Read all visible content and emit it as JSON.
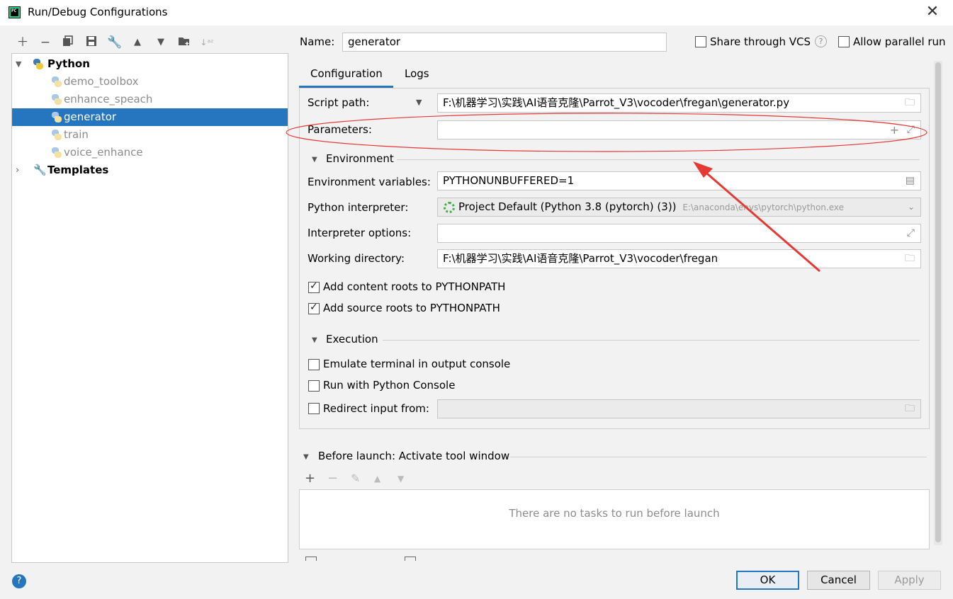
{
  "window": {
    "title": "Run/Debug Configurations",
    "logo_text": "PC"
  },
  "tree": {
    "root": "Python",
    "items": [
      "demo_toolbox",
      "enhance_speach",
      "generator",
      "train",
      "voice_enhance"
    ],
    "templates": "Templates"
  },
  "header": {
    "name_label": "Name:",
    "name_value": "generator",
    "share_vcs": "Share through VCS",
    "allow_parallel": "Allow parallel run"
  },
  "tabs": [
    "Configuration",
    "Logs"
  ],
  "form": {
    "script_path_label": "Script path:",
    "script_path_value": "F:\\机器学习\\实践\\AI语音克隆\\Parrot_V3\\vocoder\\fregan\\generator.py",
    "parameters_label": "Parameters:",
    "parameters_value": "",
    "environment_section": "Environment",
    "env_vars_label": "Environment variables:",
    "env_vars_value": "PYTHONUNBUFFERED=1",
    "interpreter_label": "Python interpreter:",
    "interpreter_value": "Project Default (Python 3.8 (pytorch) (3))",
    "interpreter_path": "E:\\anaconda\\envs\\pytorch\\python.exe",
    "interp_options_label": "Interpreter options:",
    "interp_options_value": "",
    "working_dir_label": "Working directory:",
    "working_dir_value": "F:\\机器学习\\实践\\AI语音克隆\\Parrot_V3\\vocoder\\fregan",
    "add_content_roots": "Add content roots to PYTHONPATH",
    "add_source_roots": "Add source roots to PYTHONPATH",
    "execution_section": "Execution",
    "emulate_terminal": "Emulate terminal in output console",
    "run_with_console": "Run with Python Console",
    "redirect_input": "Redirect input from:"
  },
  "before_launch": {
    "title": "Before launch: Activate tool window",
    "empty_text": "There are no tasks to run before launch"
  },
  "buttons": {
    "ok": "OK",
    "cancel": "Cancel",
    "apply": "Apply"
  },
  "colors": {
    "accent": "#2675bf",
    "annotation": "#e53935"
  }
}
